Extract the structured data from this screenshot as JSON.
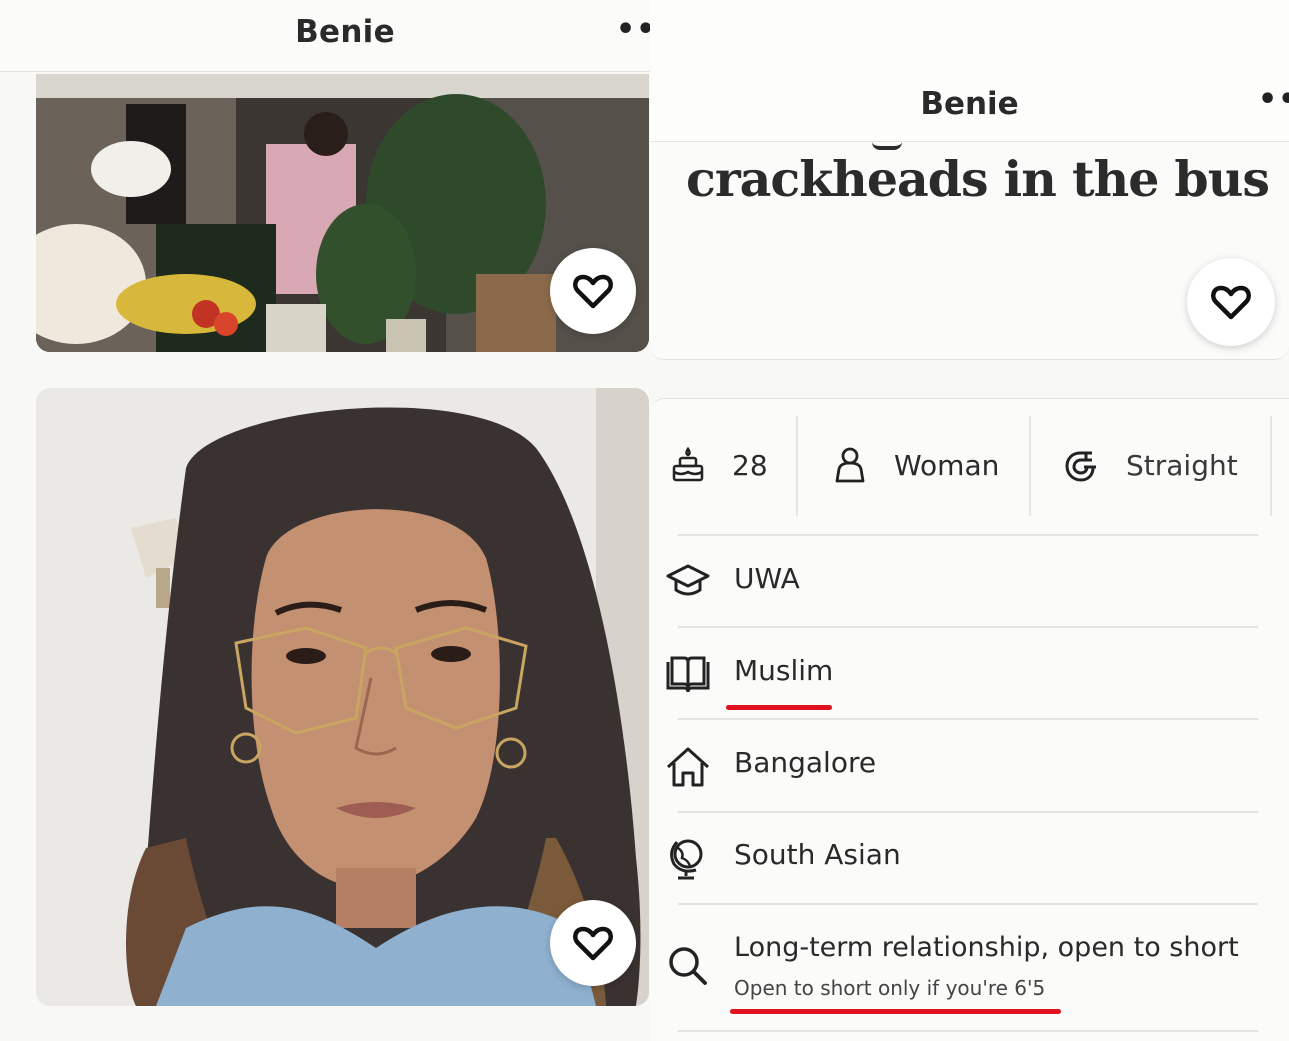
{
  "left_screen": {
    "title": "Benie",
    "menu_icon": "more-dots-icon",
    "photos": [
      {
        "subject": "",
        "like_icon": "heart-icon"
      },
      {
        "subject": "",
        "like_icon": "heart-icon"
      }
    ]
  },
  "right_screen": {
    "title": "Benie",
    "menu_icon": "more-dots-icon",
    "prompt_answer": "crackheads in the bus",
    "like_icon": "heart-icon",
    "stats": {
      "age": "28",
      "gender": "Woman",
      "orientation": "Straight"
    },
    "details": {
      "education": "UWA",
      "religion": "Muslim",
      "hometown": "Bangalore",
      "ethnicity": "South Asian",
      "intention": "Long-term relationship, open to short",
      "intention_note": "Open to short only if you're 6'5"
    }
  },
  "colors": {
    "annotation_underline": "#e0101c",
    "background": "#f8f8f6",
    "text": "#2a2a2a"
  }
}
